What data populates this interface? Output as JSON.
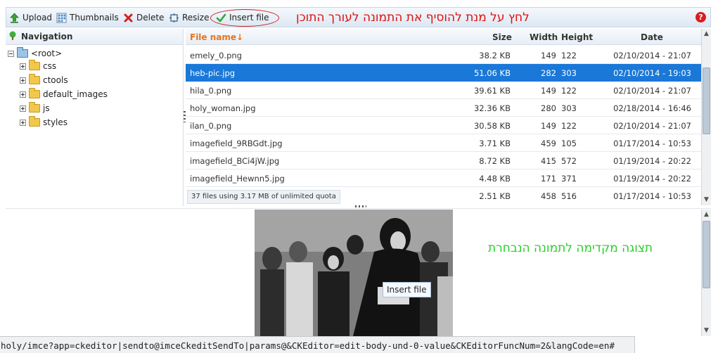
{
  "toolbar": {
    "upload_label": "Upload",
    "thumbnails_label": "Thumbnails",
    "delete_label": "Delete",
    "resize_label": "Resize",
    "insert_label": "Insert file",
    "help_label": "?",
    "annotation": "לחץ על מנת להוסיף את התמונה לעורך התוכן",
    "annotation_color": "#e01010"
  },
  "navigation": {
    "title": "Navigation",
    "root": "<root>",
    "folders": [
      "css",
      "ctools",
      "default_images",
      "js",
      "styles"
    ]
  },
  "files": {
    "columns": {
      "name": "File name↓",
      "size": "Size",
      "width": "Width",
      "height": "Height",
      "date": "Date"
    },
    "rows": [
      {
        "name": "emely_0.png",
        "size": "38.2 KB",
        "width": "149",
        "height": "122",
        "date": "02/10/2014 - 21:07",
        "selected": false
      },
      {
        "name": "heb-pic.jpg",
        "size": "51.06 KB",
        "width": "282",
        "height": "303",
        "date": "02/10/2014 - 19:03",
        "selected": true
      },
      {
        "name": "hila_0.png",
        "size": "39.61 KB",
        "width": "149",
        "height": "122",
        "date": "02/10/2014 - 21:07",
        "selected": false
      },
      {
        "name": "holy_woman.jpg",
        "size": "32.36 KB",
        "width": "280",
        "height": "303",
        "date": "02/18/2014 - 16:46",
        "selected": false
      },
      {
        "name": "ilan_0.png",
        "size": "30.58 KB",
        "width": "149",
        "height": "122",
        "date": "02/10/2014 - 21:07",
        "selected": false
      },
      {
        "name": "imagefield_9RBGdt.jpg",
        "size": "3.71 KB",
        "width": "459",
        "height": "105",
        "date": "01/17/2014 - 10:53",
        "selected": false
      },
      {
        "name": "imagefield_BCi4jW.jpg",
        "size": "8.72 KB",
        "width": "415",
        "height": "572",
        "date": "01/19/2014 - 20:22",
        "selected": false
      },
      {
        "name": "imagefield_Hewnn5.jpg",
        "size": "4.48 KB",
        "width": "171",
        "height": "371",
        "date": "01/19/2014 - 20:22",
        "selected": false
      },
      {
        "name": "",
        "size": "2.51 KB",
        "width": "458",
        "height": "516",
        "date": "01/17/2014 - 10:53",
        "selected": false
      }
    ],
    "quota": "37 files using 3.17 MB of unlimited quota",
    "selected_color": "#1a78d8"
  },
  "preview": {
    "annotation": "תצוגה מקדימה לתמונה הנבחרת",
    "annotation_color": "#28d028",
    "tooltip": "Insert file"
  },
  "status_bar": "holy/imce?app=ckeditor|sendto@imceCkeditSendTo|params@&CKEditor=edit-body-und-0-value&CKEditorFuncNum=2&langCode=en#"
}
